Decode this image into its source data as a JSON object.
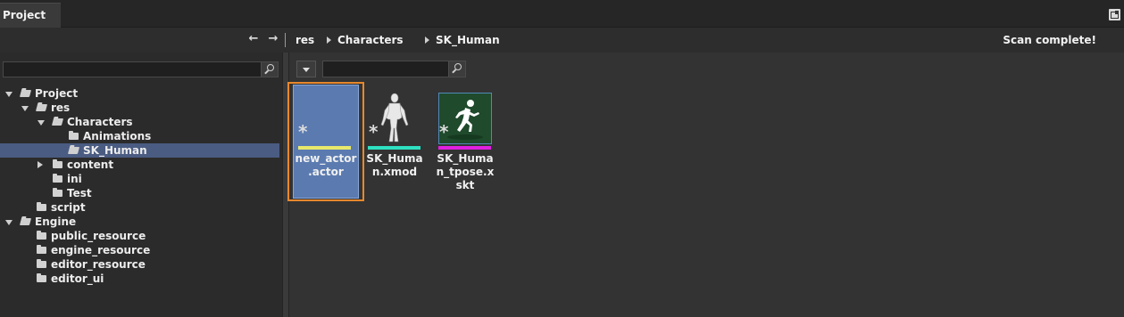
{
  "tab": {
    "title": "Project"
  },
  "toolbar": {
    "back_label": "←",
    "forward_label": "→",
    "breadcrumbs": [
      "res",
      "Characters",
      "SK_Human"
    ],
    "status": "Scan complete!"
  },
  "left_search": {
    "value": "",
    "placeholder": ""
  },
  "tree": [
    {
      "label": "Project",
      "depth": 0,
      "expander": "open",
      "icon": "folder-open-icon"
    },
    {
      "label": "res",
      "depth": 1,
      "expander": "open",
      "icon": "folder-open-icon"
    },
    {
      "label": "Characters",
      "depth": 2,
      "expander": "open",
      "icon": "folder-open-icon"
    },
    {
      "label": "Animations",
      "depth": 3,
      "expander": "none",
      "icon": "folder-icon"
    },
    {
      "label": "SK_Human",
      "depth": 3,
      "expander": "none",
      "icon": "folder-open-icon",
      "selected": true
    },
    {
      "label": "content",
      "depth": 2,
      "expander": "closed",
      "icon": "folder-icon"
    },
    {
      "label": "ini",
      "depth": 2,
      "expander": "none",
      "icon": "folder-icon"
    },
    {
      "label": "Test",
      "depth": 2,
      "expander": "none",
      "icon": "folder-icon"
    },
    {
      "label": "script",
      "depth": 1,
      "expander": "none",
      "icon": "folder-icon"
    },
    {
      "label": "Engine",
      "depth": 0,
      "expander": "open",
      "icon": "folder-open-icon"
    },
    {
      "label": "public_resource",
      "depth": 1,
      "expander": "none",
      "icon": "folder-icon"
    },
    {
      "label": "engine_resource",
      "depth": 1,
      "expander": "none",
      "icon": "folder-icon"
    },
    {
      "label": "editor_resource",
      "depth": 1,
      "expander": "none",
      "icon": "folder-icon"
    },
    {
      "label": "editor_ui",
      "depth": 1,
      "expander": "none",
      "icon": "folder-icon"
    }
  ],
  "content_search": {
    "value": "",
    "placeholder": ""
  },
  "files": [
    {
      "name": "new_actor.actor",
      "name_lines": [
        "new_actor",
        ".actor"
      ],
      "type_color": "#e8e86a",
      "icon": "actor-icon",
      "selected": true
    },
    {
      "name": "SK_Human.xmod",
      "name_lines": [
        "SK_Huma",
        "n.xmod"
      ],
      "type_color": "#2ee0c0",
      "icon": "human-mesh-icon"
    },
    {
      "name": "SK_Human_tpose.xskt",
      "name_lines": [
        "SK_Huma",
        "n_tpose.x",
        "skt"
      ],
      "type_color": "#e020e0",
      "icon": "running-man-icon"
    }
  ],
  "colors": {
    "selection_border": "#e8882c",
    "tree_selection": "#4a5c82"
  }
}
